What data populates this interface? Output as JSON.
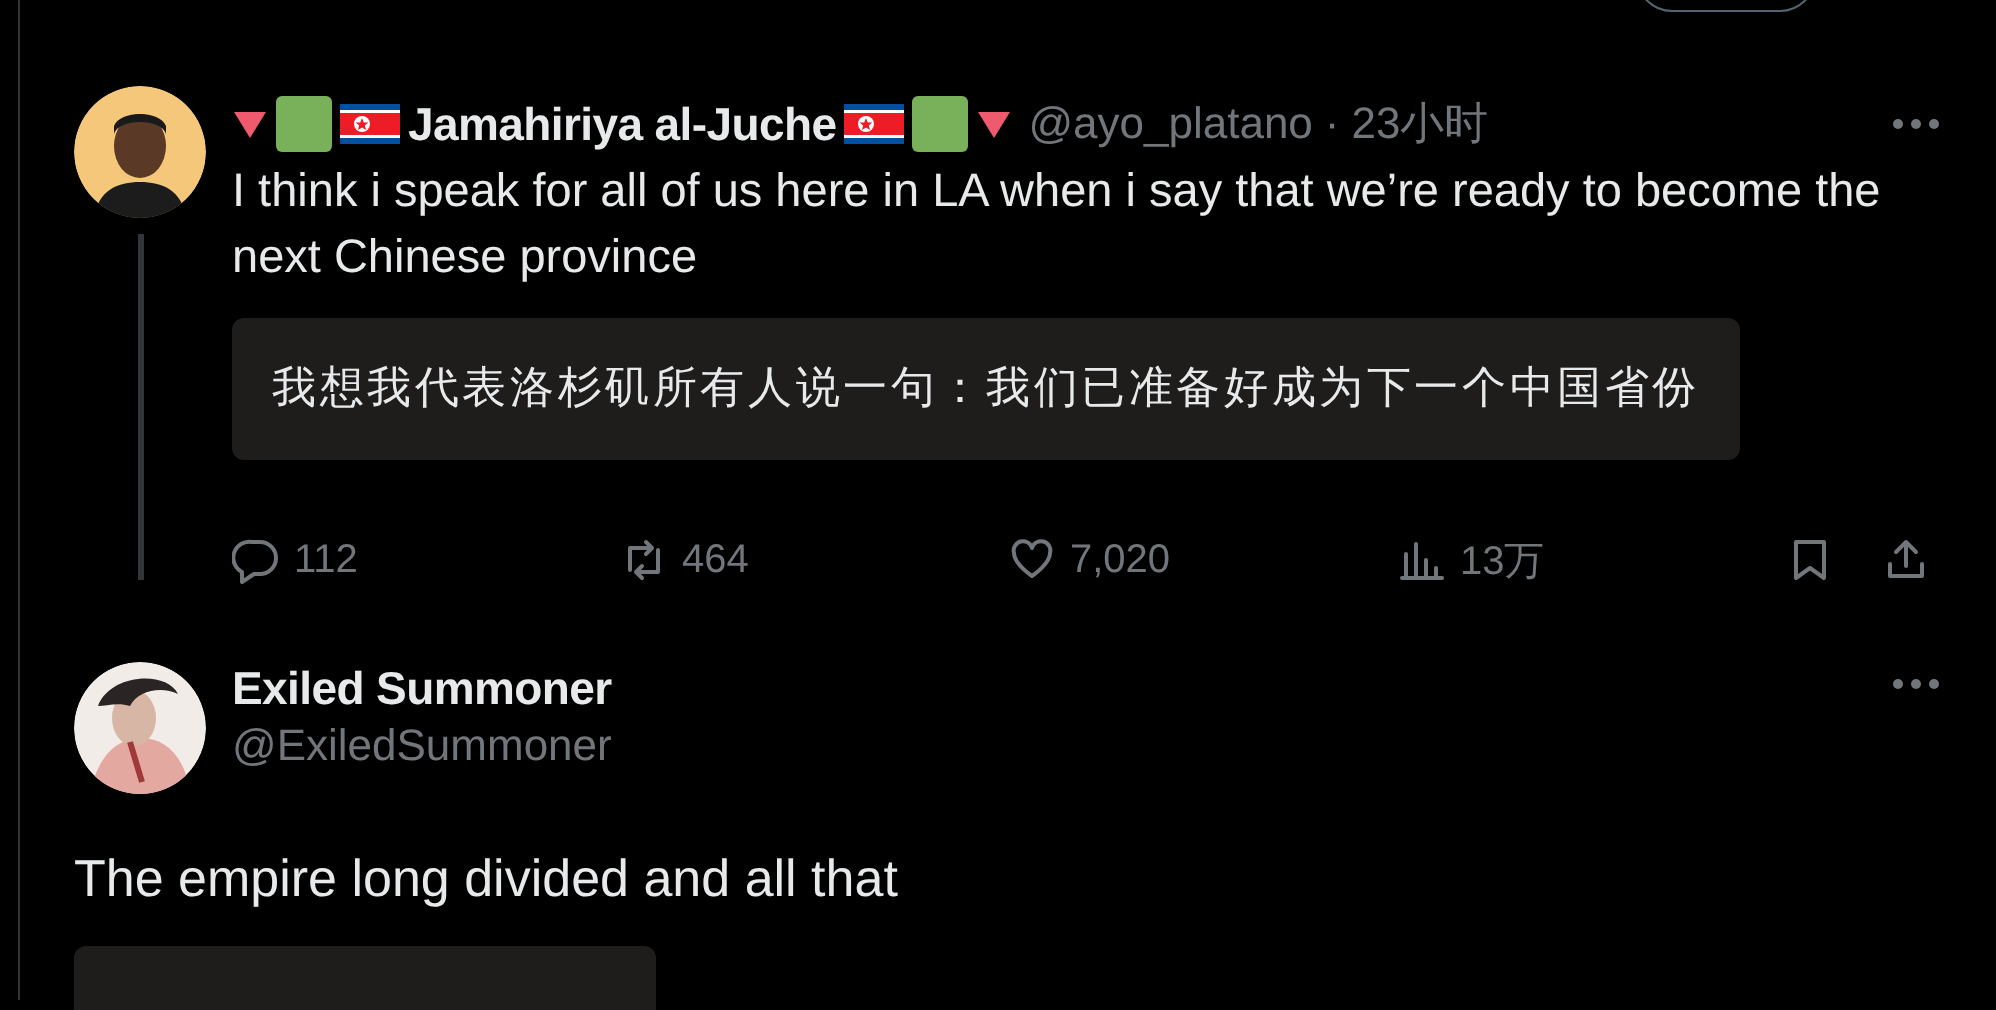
{
  "posts": [
    {
      "author": "Jamahiriya al-Juche",
      "handle": "@ayo_platano",
      "separator": "·",
      "time": "23小时",
      "text": "I think i speak for all of us here in LA when i say that we’re ready to become the next Chinese province",
      "translation": "我想我代表洛杉矶所有人说一句：我们已准备好成为下一个中国省份",
      "actions": [
        {
          "kind": "reply",
          "count": "112"
        },
        {
          "kind": "repost",
          "count": "464"
        },
        {
          "kind": "like",
          "count": "7,020"
        },
        {
          "kind": "views",
          "count": "13万"
        },
        {
          "kind": "bookmark"
        },
        {
          "kind": "share"
        }
      ],
      "thread_line": true
    },
    {
      "author": "Exiled Summoner",
      "handle": "@ExiledSummoner",
      "text": "The empire long divided and all that",
      "translation_box": true
    }
  ]
}
